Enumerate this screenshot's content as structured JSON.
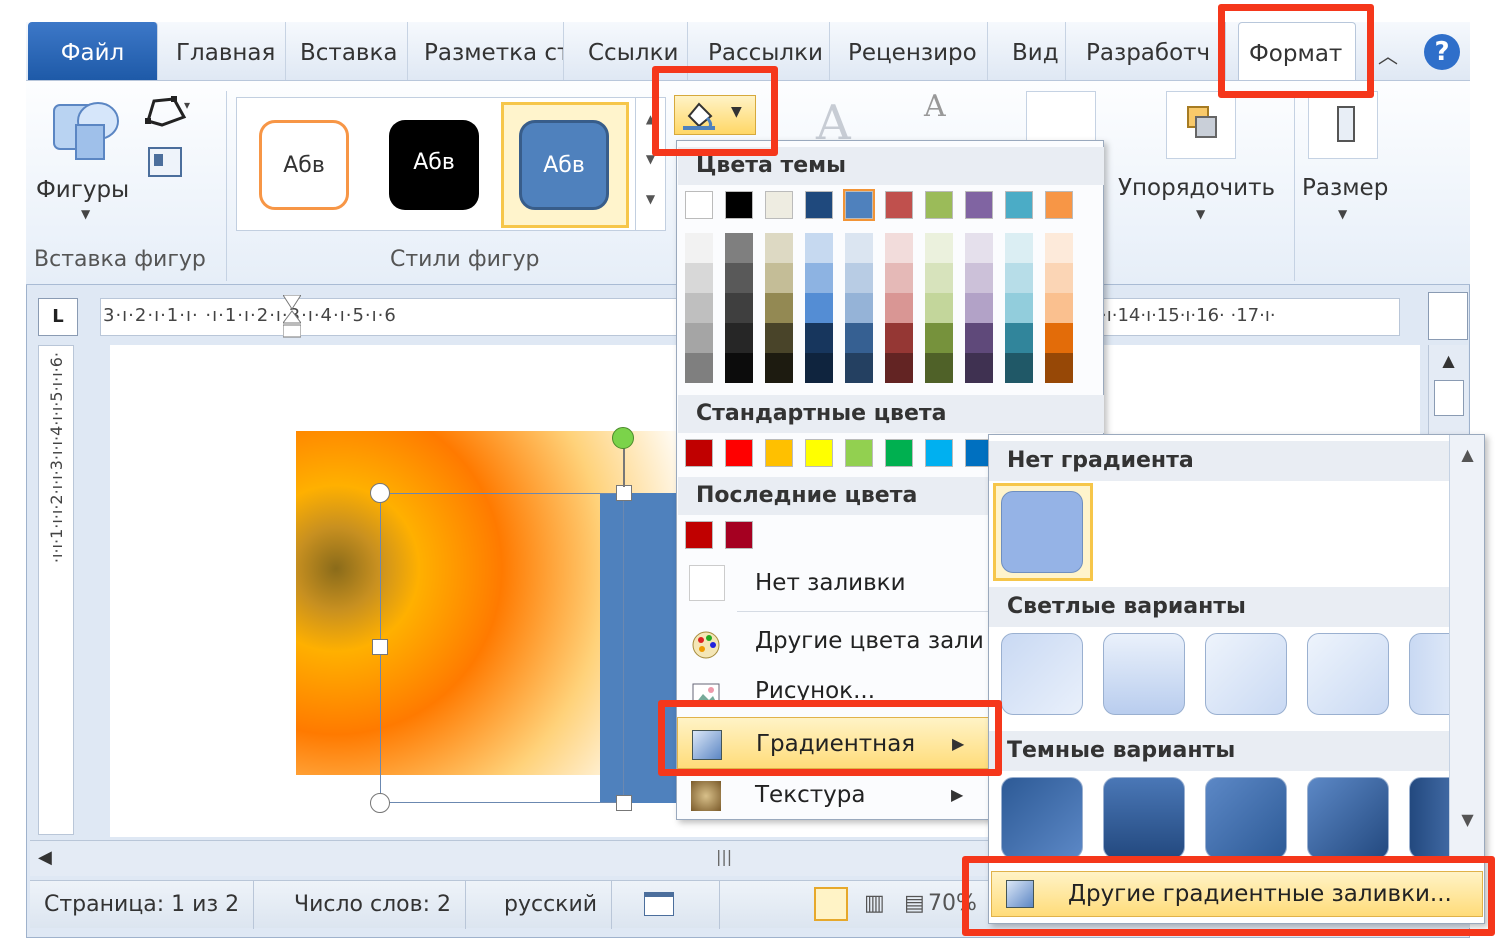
{
  "tabs": {
    "file": "Файл",
    "items": [
      "Главная",
      "Вставка",
      "Разметка ст",
      "Ссылки",
      "Рассылки",
      "Рецензиро",
      "Вид",
      "Разработч"
    ],
    "active": "Формат"
  },
  "ribbon": {
    "shapes_label": "Фигуры",
    "insert_shapes_group": "Вставка фигур",
    "styles_group": "Стили фигур",
    "style_samples": [
      "Абв",
      "Абв",
      "Абв"
    ],
    "arrange_label": "Упорядочить",
    "size_label": "Размер",
    "text_a": "A"
  },
  "ruler_text": "3·ı·2·ı·1·ı·   ·ı·1·ı·2·ı·3·ı·4·ı·5·ı·6",
  "ruler_right": "·ı·14·ı·15·ı·16·  ·17·ı·",
  "vruler_text": "·ı·ı·1·ı·ı·2·ı·ı·3·ı·ı·4·ı·ı·5·ı·ı·6·",
  "menu": {
    "theme_colors": "Цвета темы",
    "standard_colors": "Стандартные цвета",
    "recent_colors": "Последние цвета",
    "no_fill": "Нет заливки",
    "more_colors": "Другие цвета зали",
    "picture": "Рисунок...",
    "gradient": "Градиентная",
    "texture": "Текстура",
    "theme_top": [
      "#ffffff",
      "#000000",
      "#eeece1",
      "#1f497d",
      "#4f81bd",
      "#c0504d",
      "#9bbb59",
      "#8064a2",
      "#4bacc6",
      "#f79646"
    ],
    "theme_shades": [
      [
        "#f2f2f2",
        "#d8d8d8",
        "#bfbfbf",
        "#a5a5a5",
        "#7f7f7f"
      ],
      [
        "#7f7f7f",
        "#595959",
        "#3f3f3f",
        "#262626",
        "#0c0c0c"
      ],
      [
        "#ddd9c3",
        "#c4bd97",
        "#938953",
        "#494429",
        "#1d1b10"
      ],
      [
        "#c6d9f0",
        "#8db3e2",
        "#548dd4",
        "#17365d",
        "#0f243e"
      ],
      [
        "#dbe5f1",
        "#b8cce4",
        "#95b3d7",
        "#366092",
        "#244061"
      ],
      [
        "#f2dcdb",
        "#e5b9b7",
        "#d99694",
        "#953734",
        "#632423"
      ],
      [
        "#ebf1dd",
        "#d7e3bc",
        "#c3d69b",
        "#76923c",
        "#4f6128"
      ],
      [
        "#e5e0ec",
        "#ccc1d9",
        "#b2a2c7",
        "#5f497a",
        "#3f3151"
      ],
      [
        "#dbeef3",
        "#b7dde8",
        "#92cddc",
        "#31859b",
        "#205867"
      ],
      [
        "#fdeada",
        "#fbd5b5",
        "#fac08f",
        "#e36c09",
        "#974806"
      ]
    ],
    "standard": [
      "#c00000",
      "#ff0000",
      "#ffc000",
      "#ffff00",
      "#92d050",
      "#00b050",
      "#00b0f0",
      "#0070c0"
    ],
    "recent": [
      "#c00000",
      "#a50021"
    ]
  },
  "submenu": {
    "no_gradient": "Нет градиента",
    "light": "Светлые варианты",
    "dark": "Темные варианты",
    "more": "Другие градиентные заливки..."
  },
  "status": {
    "page": "Страница: 1 из 2",
    "words": "Число слов: 2",
    "lang": "русский",
    "zoom": "70%"
  },
  "colors": {
    "highlight": "#f5371b",
    "accent": "#4f81bd",
    "ribbon": "#dfe8f4"
  }
}
